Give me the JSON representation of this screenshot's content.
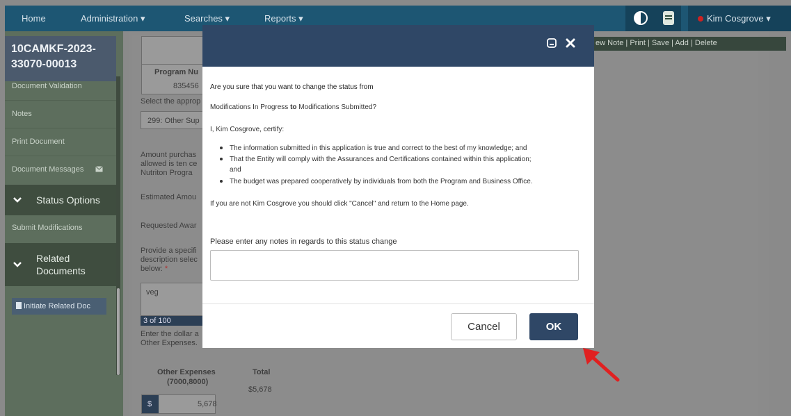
{
  "nav": {
    "home": "Home",
    "administration": "Administration ▾",
    "searches": "Searches ▾",
    "reports": "Reports ▾",
    "user": "Kim Cosgrove ▾"
  },
  "sidebar": {
    "doc_title_line1": "10CAMKF-2023-",
    "doc_title_line2": "33070-00013",
    "items": [
      "Document Validation",
      "Notes",
      "Print Document",
      "Document Messages"
    ],
    "status_options": "Status Options",
    "submit_modifications": "Submit Modifications",
    "related_documents_line1": "Related",
    "related_documents_line2": "Documents",
    "initiate_related_doc": "Initiate Related Doc"
  },
  "toolbar": {
    "items": "ew Note  |  Print  |  Save  |  Add  |  Delete"
  },
  "background": {
    "program_number_label": "Program Nu",
    "program_number_value": "835456",
    "select_approp": "Select the approp",
    "select_value": "299: Other Sup",
    "amount_text_1": "Amount purchas",
    "amount_text_2": "allowed is ten ce",
    "amount_text_3": "Nutriton Progra",
    "estimated_amount": "Estimated Amou",
    "requested_award": "Requested Awar",
    "provide_specific_1": "Provide a specifi",
    "provide_specific_2": "description selec",
    "provide_specific_3": "below:",
    "required_mark": "*",
    "veg_value": "veg",
    "char_count": "3 of 100",
    "enter_dollar_1": "Enter the dollar a",
    "enter_dollar_2": "Other Expenses.",
    "other_expenses_label_1": "Other Expenses",
    "other_expenses_label_2": "(7000,8000)",
    "total_label": "Total",
    "total_value": "$5,678",
    "currency_symbol": "$",
    "other_expenses_value": "5,678"
  },
  "modal": {
    "question": "Are you sure that you want to change the status from",
    "status_from": "Modifications In Progress",
    "to_word": "to",
    "status_to": "Modifications Submitted?",
    "certify": "I, Kim Cosgrove, certify:",
    "bullet1": "The information submitted in this application is true and correct to the best of my knowledge; and",
    "bullet2_line1": "That the Entity will comply with the Assurances and Certifications contained within this application;",
    "bullet2_line2": "and",
    "bullet3": "The budget was prepared cooperatively by individuals from both the Program and Business Office.",
    "not_user_note": "If you are not Kim Cosgrove you should click \"Cancel\" and return to the Home page.",
    "notes_label": "Please enter any notes in regards to this status change",
    "notes_value": "",
    "cancel_label": "Cancel",
    "ok_label": "OK"
  },
  "colors": {
    "nav": "#1d5673",
    "modal_header": "#2f4766",
    "ok_button": "#2f4766",
    "arrow": "#e02020"
  }
}
